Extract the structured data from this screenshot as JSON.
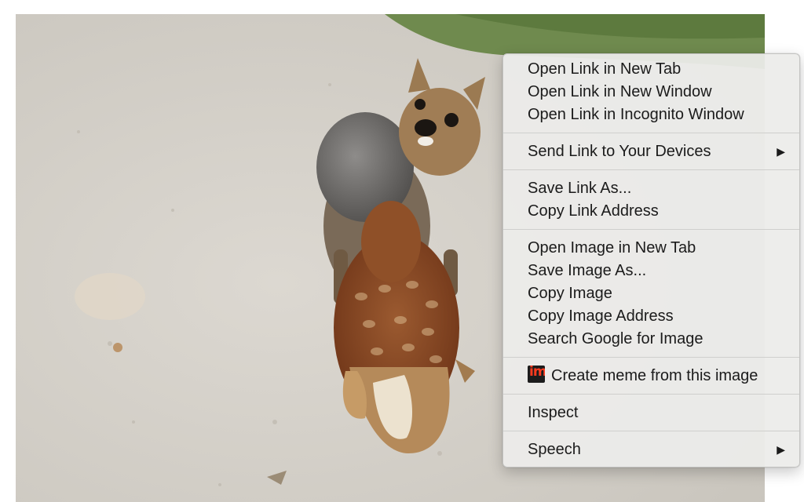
{
  "context_menu": {
    "items": [
      {
        "label": "Open Link in New Tab"
      },
      {
        "label": "Open Link in New Window"
      },
      {
        "label": "Open Link in Incognito Window"
      },
      {
        "label": "Send Link to Your Devices"
      },
      {
        "label": "Save Link As..."
      },
      {
        "label": "Copy Link Address"
      },
      {
        "label": "Open Image in New Tab"
      },
      {
        "label": "Save Image As..."
      },
      {
        "label": "Copy Image"
      },
      {
        "label": "Copy Image Address"
      },
      {
        "label": "Search Google for Image"
      },
      {
        "label": "Create meme from this image",
        "icon": "imgflip-meme-icon"
      },
      {
        "label": "Inspect"
      },
      {
        "label": "Speech"
      }
    ],
    "submenu_arrow_icon": "triangle-right-icon"
  },
  "photo": {
    "subject": "small terrier dog and brown hen on sandy ground",
    "colors": {
      "ground": "#d3d0c9",
      "grass": "#6f8a4e",
      "hen": "#8a4a26",
      "dog": "#6e6b68"
    }
  }
}
